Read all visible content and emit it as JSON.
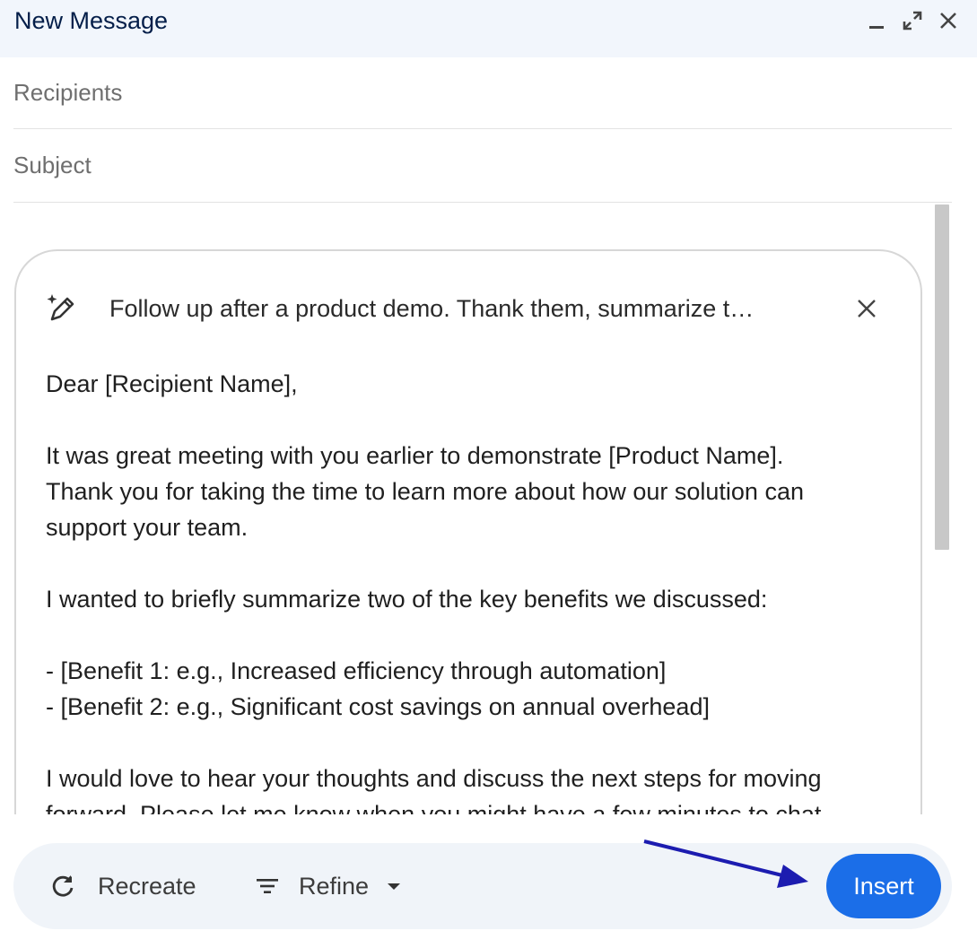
{
  "window": {
    "title": "New Message",
    "controls": {
      "minimize_icon": "minimize-icon",
      "expand_icon": "expand-icon",
      "close_icon": "close-icon"
    }
  },
  "fields": {
    "recipients_placeholder": "Recipients",
    "subject_placeholder": "Subject"
  },
  "ai_card": {
    "icon": "pen-sparkle-icon",
    "prompt": "Follow up after a product demo. Thank them, summarize t…",
    "close_icon": "close-icon",
    "body": {
      "greeting": "Dear [Recipient Name],",
      "para1_line1": "It was great meeting with you earlier to demonstrate [Product Name].",
      "para1_line2": "Thank you for taking the time to learn more about how our solution can",
      "para1_line3": "support your team.",
      "para2": "I wanted to briefly summarize two of the key benefits we discussed:",
      "bullet1": "- [Benefit 1: e.g., Increased efficiency through automation]",
      "bullet2": "- [Benefit 2: e.g., Significant cost savings on annual overhead]",
      "para3_line1": "I would love to hear your thoughts and discuss the next steps for moving",
      "para3_line2": "forward. Please let me know when you might have a few minutes to chat."
    }
  },
  "actions": {
    "recreate_label": "Recreate",
    "recreate_icon": "refresh-icon",
    "refine_label": "Refine",
    "refine_icon": "filter-lines-icon",
    "refine_caret_icon": "caret-down-icon",
    "insert_label": "Insert"
  },
  "colors": {
    "header_bg": "#f2f6fc",
    "title_color": "#041e49",
    "bottom_bar_bg": "#f0f4f9",
    "insert_bg": "#1b6ee8",
    "annotation_arrow": "#1c1cb0"
  }
}
